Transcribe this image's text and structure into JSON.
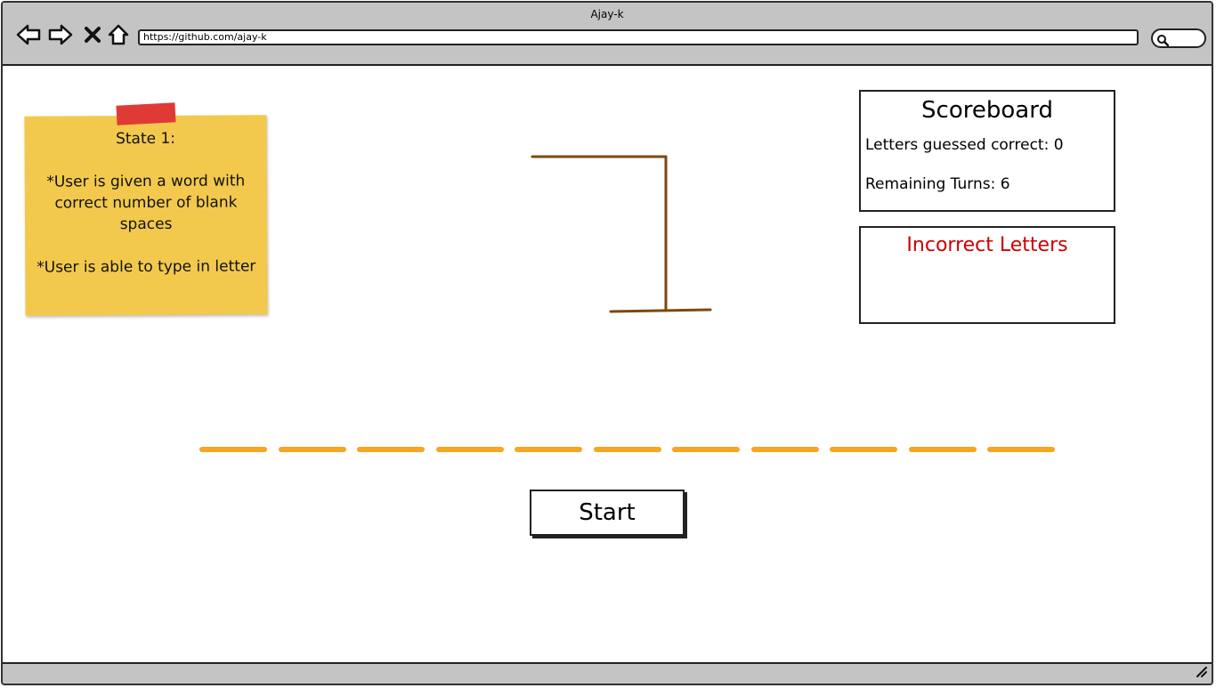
{
  "window": {
    "title": "Ajay-k",
    "url": "https://github.com/ajay-k"
  },
  "note": {
    "heading": "State 1:",
    "lines": [
      "*User is given a word with correct number of blank spaces",
      "*User is able to type in letter"
    ]
  },
  "scoreboard": {
    "title": "Scoreboard",
    "correct_label": "Letters guessed correct: 0",
    "remaining_label": "Remaining Turns: 6"
  },
  "incorrect": {
    "title": "Incorrect Letters"
  },
  "word": {
    "blank_count": 11
  },
  "controls": {
    "start_label": "Start"
  },
  "colors": {
    "chrome": "#c4c4c4",
    "sticky": "#f2c94c",
    "tape": "#e03a36",
    "gallows": "#7a4a10",
    "blank": "#f5a623",
    "incorrect_title": "#cc0000"
  }
}
